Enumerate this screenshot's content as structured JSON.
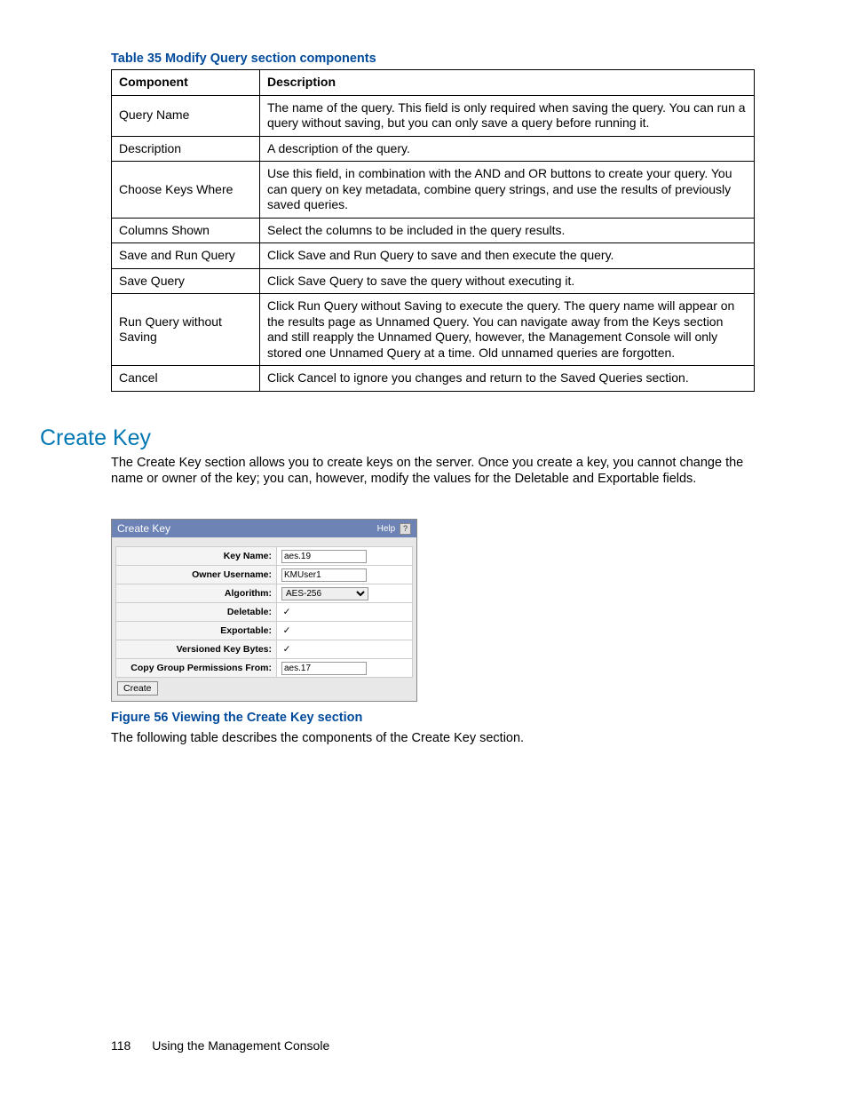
{
  "table": {
    "caption": "Table 35 Modify Query section components",
    "headers": {
      "c1": "Component",
      "c2": "Description"
    },
    "rows": [
      {
        "c1": "Query Name",
        "c2": "The name of the query. This field is only required when saving the query. You can run a query without saving, but you can only save a query before running it."
      },
      {
        "c1": "Description",
        "c2": "A description of the query."
      },
      {
        "c1": "Choose Keys Where",
        "c2": "Use this field, in combination with the AND and OR buttons to create your query. You can query on key metadata, combine query strings, and use the results of previously saved queries."
      },
      {
        "c1": "Columns Shown",
        "c2": "Select the columns to be included in the query results."
      },
      {
        "c1": "Save and Run Query",
        "c2": "Click Save and Run Query to save and then execute the query."
      },
      {
        "c1": "Save Query",
        "c2": "Click Save Query to save the query without executing it."
      },
      {
        "c1": "Run Query without Saving",
        "c2": "Click Run Query without Saving to execute the query. The query name will appear on the results page as Unnamed Query. You can navigate away from the Keys section and still reapply the Unnamed Query, however, the Management Console will only stored one Unnamed Query at a time. Old unnamed queries are forgotten."
      },
      {
        "c1": "Cancel",
        "c2": "Click Cancel to ignore you changes and return to the Saved Queries section."
      }
    ]
  },
  "section": {
    "heading": "Create Key",
    "paragraph": "The Create Key section allows you to create keys on the server. Once you create a key, you cannot change the name or owner of the key; you can, however, modify the values for the Deletable and Exportable fields."
  },
  "ck": {
    "title": "Create Key",
    "help": "Help",
    "help_q": "?",
    "labels": {
      "keyname": "Key Name:",
      "owner": "Owner Username:",
      "algo": "Algorithm:",
      "deletable": "Deletable:",
      "exportable": "Exportable:",
      "versioned": "Versioned Key Bytes:",
      "copyperm": "Copy Group Permissions From:"
    },
    "values": {
      "keyname": "aes.19",
      "owner": "KMUser1",
      "algo": "AES-256",
      "copyperm": "aes.17",
      "check": "✓"
    },
    "create_btn": "Create"
  },
  "figure_caption": "Figure 56 Viewing the Create Key section",
  "after_figure_p": "The following table describes the components of the Create Key section.",
  "footer": {
    "page": "118",
    "chapter": "Using the Management Console"
  }
}
